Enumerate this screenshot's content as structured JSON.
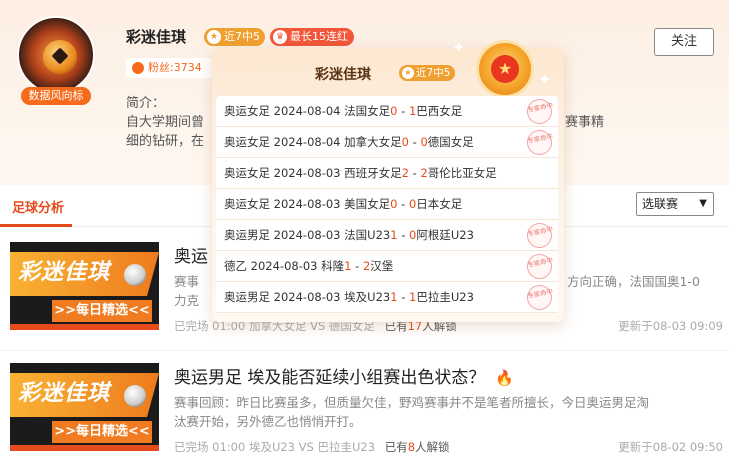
{
  "profile": {
    "avatar_tag": "数据风向标",
    "name": "彩迷佳琪",
    "badge_recent": "近7中5",
    "badge_streak": "最长15连红",
    "fans": "粉丝:3734",
    "intro_label": "简介：",
    "intro_line1": "自大学期间曾",
    "intro_line2": "细的钻研，在",
    "intro_right1": "赛事精",
    "intro_right2": "",
    "follow_label": "关注"
  },
  "tabs": {
    "active": "足球分析",
    "league_select": "选联赛"
  },
  "popup": {
    "title": "彩迷佳琪",
    "badge": "近7中5",
    "stamp_text": "专家命中",
    "matches": [
      {
        "league": "奥运女足",
        "date": "2024-08-04",
        "home": "法国女足",
        "hs": "0",
        "as": "1",
        "away": "巴西女足",
        "hit": true
      },
      {
        "league": "奥运女足",
        "date": "2024-08-04",
        "home": "加拿大女足",
        "hs": "0",
        "as": "0",
        "away": "德国女足",
        "hit": true
      },
      {
        "league": "奥运女足",
        "date": "2024-08-03",
        "home": "西班牙女足",
        "hs": "2",
        "as": "2",
        "away": "哥伦比亚女足",
        "hit": false
      },
      {
        "league": "奥运女足",
        "date": "2024-08-03",
        "home": "美国女足",
        "hs": "0",
        "as": "0",
        "away": "日本女足",
        "hit": false
      },
      {
        "league": "奥运男足",
        "date": "2024-08-03",
        "home": "法国U23",
        "hs": "1",
        "as": "0",
        "away": "阿根廷U23",
        "hit": true
      },
      {
        "league": "德乙",
        "date": "2024-08-03",
        "home": "科隆",
        "hs": "1",
        "as": "2",
        "away": "汉堡",
        "hit": true
      },
      {
        "league": "奥运男足",
        "date": "2024-08-03",
        "home": "埃及U23",
        "hs": "1",
        "as": "1",
        "away": "巴拉圭U23",
        "hit": true
      }
    ]
  },
  "articles": [
    {
      "thumb_title": "彩迷佳琪",
      "thumb_sub": ">>每日精选<<",
      "title": "奥运",
      "summary_line1": "赛事",
      "summary_right1": "方向正确，法国国奥1-0",
      "summary_line2": "力克",
      "meta_status": "已完场 01:00 加拿大女足 VS 德国女足",
      "unlock_prefix": "已有",
      "unlock_count": "17",
      "unlock_suffix": "人解锁",
      "update": "更新于08-03 09:09"
    },
    {
      "thumb_title": "彩迷佳琪",
      "thumb_sub": ">>每日精选<<",
      "title": "奥运男足 埃及能否延续小组赛出色状态？",
      "summary_line1": "赛事回顾：昨日比赛虽多，但质量欠佳，野鸡赛事并不是笔者所擅长，今日奥运男足淘",
      "summary_line2": "汰赛开始，另外德乙也悄悄开打。",
      "meta_status": "已完场 01:00 埃及U23 VS 巴拉圭U23",
      "unlock_prefix": "已有",
      "unlock_count": "8",
      "unlock_suffix": "人解锁",
      "update": "更新于08-02 09:50"
    }
  ]
}
